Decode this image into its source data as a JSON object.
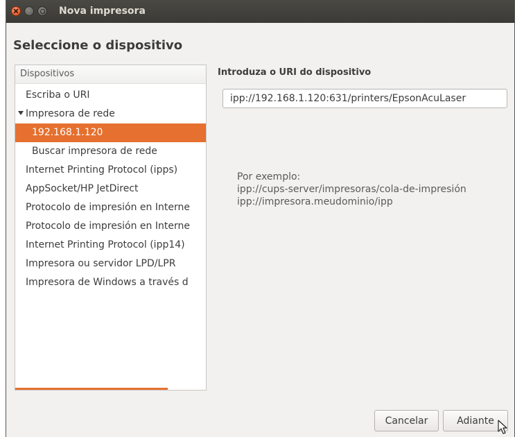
{
  "window": {
    "title": "Nova impresora"
  },
  "heading": "Seleccione o dispositivo",
  "devices": {
    "header": "Dispositivos",
    "items": [
      {
        "label": "Escriba o URI",
        "level": 1
      },
      {
        "label": "Impresora de rede",
        "level": 0,
        "expanded": true
      },
      {
        "label": "192.168.1.120",
        "level": 2,
        "selected": true
      },
      {
        "label": "Buscar impresora de rede",
        "level": 2
      },
      {
        "label": "Internet Printing Protocol (ipps)",
        "level": 1
      },
      {
        "label": "AppSocket/HP JetDirect",
        "level": 1
      },
      {
        "label": "Protocolo de impresión en Interne",
        "level": 1
      },
      {
        "label": "Protocolo de impresión en Interne",
        "level": 1
      },
      {
        "label": "Internet Printing Protocol (ipp14)",
        "level": 1
      },
      {
        "label": "Impresora ou servidor LPD/LPR",
        "level": 1
      },
      {
        "label": "Impresora de Windows a través d",
        "level": 1
      }
    ]
  },
  "uri": {
    "label": "Introduza o URI do dispositivo",
    "value": "ipp://192.168.1.120:631/printers/EpsonAcuLaser"
  },
  "example": {
    "title": "Por exemplo:",
    "lines": [
      "ipp://cups-server/impresoras/cola-de-impresión",
      "ipp://impresora.meudominio/ipp"
    ]
  },
  "buttons": {
    "cancel": "Cancelar",
    "next": "Adiante"
  },
  "colors": {
    "accent": "#e5702f",
    "titlebar": "#3c3b37"
  }
}
